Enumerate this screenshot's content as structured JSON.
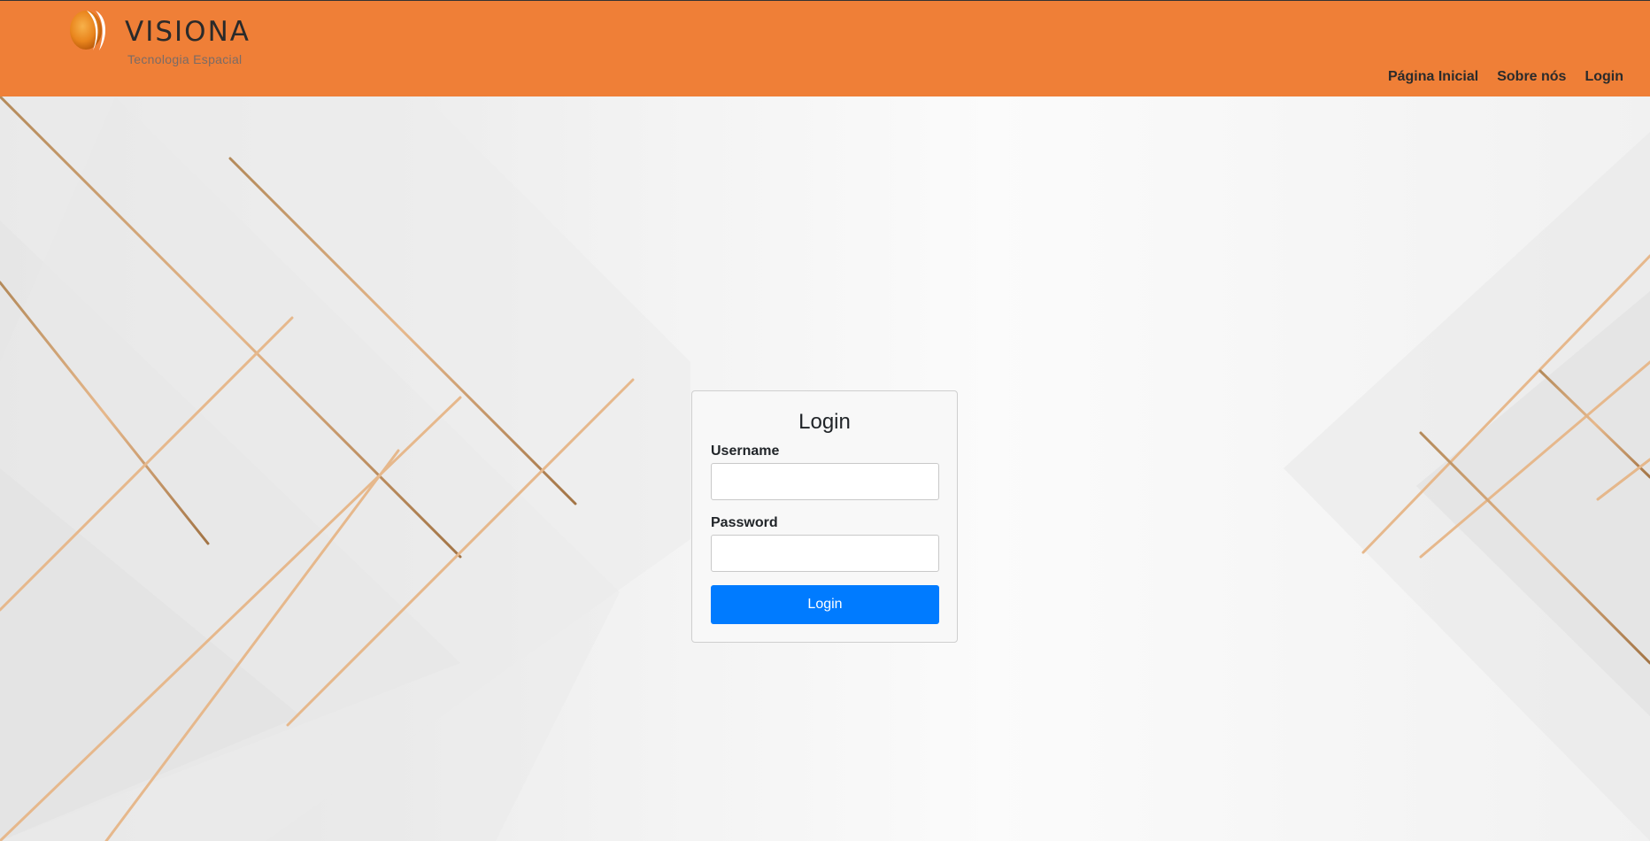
{
  "brand": {
    "name": "VISIONA",
    "tagline": "Tecnologia Espacial",
    "accent_color": "#EF7F37"
  },
  "nav": {
    "items": [
      {
        "label": "Página Inicial"
      },
      {
        "label": "Sobre nós"
      },
      {
        "label": "Login"
      }
    ]
  },
  "login_form": {
    "title": "Login",
    "username_label": "Username",
    "username_value": "",
    "password_label": "Password",
    "password_value": "",
    "submit_label": "Login",
    "submit_color": "#007BFF"
  },
  "icons": {
    "logo": "visiona-logo-mark-icon"
  }
}
